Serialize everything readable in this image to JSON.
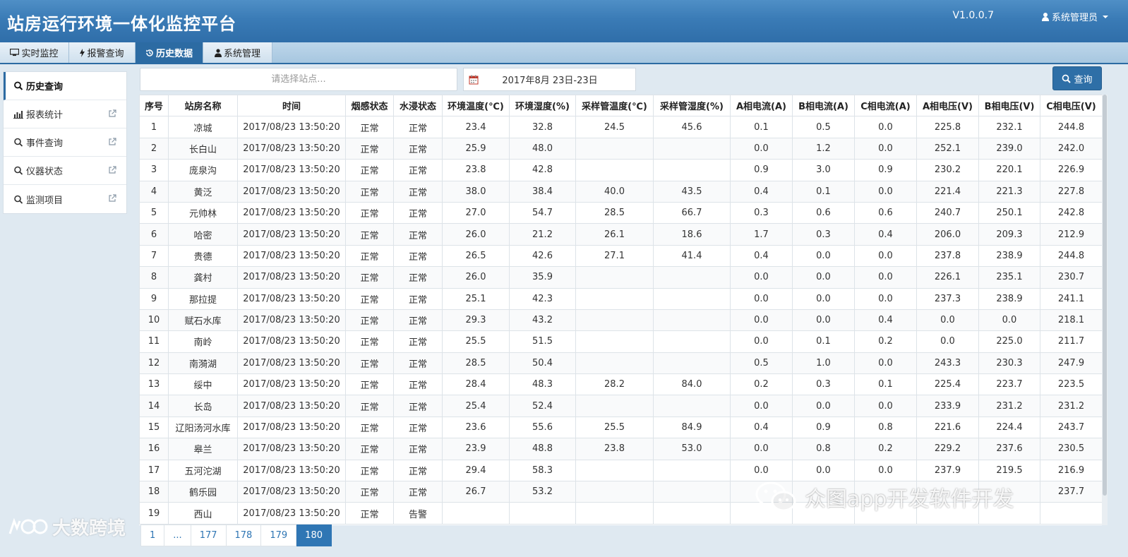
{
  "header": {
    "title": "站房运行环境一体化监控平台",
    "version": "V1.0.0.7",
    "user": "系统管理员"
  },
  "tabs": [
    {
      "label": "实时监控",
      "icon": "monitor-icon",
      "active": false
    },
    {
      "label": "报警查询",
      "icon": "bolt-icon",
      "active": false
    },
    {
      "label": "历史数据",
      "icon": "history-icon",
      "active": true
    },
    {
      "label": "系统管理",
      "icon": "user-icon",
      "active": false
    }
  ],
  "sidebar": {
    "items": [
      {
        "label": "历史查询",
        "icon": "search-icon",
        "active": true
      },
      {
        "label": "报表统计",
        "icon": "bar-chart-icon",
        "active": false
      },
      {
        "label": "事件查询",
        "icon": "search-icon",
        "active": false
      },
      {
        "label": "仪器状态",
        "icon": "search-icon",
        "active": false
      },
      {
        "label": "监测项目",
        "icon": "search-icon",
        "active": false
      }
    ]
  },
  "search": {
    "placeholder": "请选择站点...",
    "date_range": "2017年8月 23日-23日",
    "query_label": "查询"
  },
  "table": {
    "headers": [
      "序号",
      "站房名称",
      "时间",
      "烟感状态",
      "水浸状态",
      "环境温度(℃)",
      "环境湿度(%)",
      "采样管温度(℃)",
      "采样管湿度(%)",
      "A相电流(A)",
      "B相电流(A)",
      "C相电流(A)",
      "A相电压(V)",
      "B相电压(V)",
      "C相电压(V)"
    ],
    "rows": [
      [
        "1",
        "凉城",
        "2017/08/23 13:50:20",
        "正常",
        "正常",
        "23.4",
        "32.8",
        "24.5",
        "45.6",
        "0.1",
        "0.5",
        "0.0",
        "225.8",
        "232.1",
        "244.8"
      ],
      [
        "2",
        "长白山",
        "2017/08/23 13:50:20",
        "正常",
        "正常",
        "25.9",
        "48.0",
        "",
        "",
        "0.0",
        "1.2",
        "0.0",
        "252.1",
        "239.0",
        "242.0"
      ],
      [
        "3",
        "庞泉沟",
        "2017/08/23 13:50:20",
        "正常",
        "正常",
        "23.8",
        "42.8",
        "",
        "",
        "0.9",
        "3.0",
        "0.9",
        "230.2",
        "220.1",
        "226.9"
      ],
      [
        "4",
        "黄泛",
        "2017/08/23 13:50:20",
        "正常",
        "正常",
        "38.0",
        "38.4",
        "40.0",
        "43.5",
        "0.4",
        "0.1",
        "0.0",
        "221.4",
        "221.3",
        "227.8"
      ],
      [
        "5",
        "元帅林",
        "2017/08/23 13:50:20",
        "正常",
        "正常",
        "27.0",
        "54.7",
        "28.5",
        "66.7",
        "0.3",
        "0.6",
        "0.6",
        "240.7",
        "250.1",
        "242.8"
      ],
      [
        "6",
        "哈密",
        "2017/08/23 13:50:20",
        "正常",
        "正常",
        "26.0",
        "21.2",
        "26.1",
        "18.6",
        "1.7",
        "0.3",
        "0.4",
        "206.0",
        "209.3",
        "212.9"
      ],
      [
        "7",
        "贵德",
        "2017/08/23 13:50:20",
        "正常",
        "正常",
        "26.5",
        "42.6",
        "27.1",
        "41.4",
        "0.4",
        "0.0",
        "0.0",
        "237.8",
        "238.9",
        "244.8"
      ],
      [
        "8",
        "龚村",
        "2017/08/23 13:50:20",
        "正常",
        "正常",
        "26.0",
        "35.9",
        "",
        "",
        "0.0",
        "0.0",
        "0.0",
        "226.1",
        "235.1",
        "230.7"
      ],
      [
        "9",
        "那拉提",
        "2017/08/23 13:50:20",
        "正常",
        "正常",
        "25.1",
        "42.3",
        "",
        "",
        "0.0",
        "0.0",
        "0.0",
        "237.3",
        "238.9",
        "241.1"
      ],
      [
        "10",
        "赋石水库",
        "2017/08/23 13:50:20",
        "正常",
        "正常",
        "29.3",
        "43.2",
        "",
        "",
        "0.0",
        "0.0",
        "0.4",
        "0.0",
        "0.0",
        "218.1"
      ],
      [
        "11",
        "南岭",
        "2017/08/23 13:50:20",
        "正常",
        "正常",
        "25.5",
        "51.5",
        "",
        "",
        "0.0",
        "0.1",
        "0.2",
        "0.0",
        "225.0",
        "211.7"
      ],
      [
        "12",
        "南漪湖",
        "2017/08/23 13:50:20",
        "正常",
        "正常",
        "28.5",
        "50.4",
        "",
        "",
        "0.5",
        "1.0",
        "0.0",
        "243.3",
        "230.3",
        "247.9"
      ],
      [
        "13",
        "绥中",
        "2017/08/23 13:50:20",
        "正常",
        "正常",
        "28.4",
        "48.3",
        "28.2",
        "84.0",
        "0.2",
        "0.3",
        "0.1",
        "225.4",
        "223.7",
        "223.5"
      ],
      [
        "14",
        "长岛",
        "2017/08/23 13:50:20",
        "正常",
        "正常",
        "25.4",
        "52.4",
        "",
        "",
        "0.0",
        "0.0",
        "0.0",
        "233.9",
        "231.2",
        "231.2"
      ],
      [
        "15",
        "辽阳汤河水库",
        "2017/08/23 13:50:20",
        "正常",
        "正常",
        "23.6",
        "55.6",
        "25.5",
        "84.9",
        "0.4",
        "0.9",
        "0.8",
        "221.6",
        "224.4",
        "243.7"
      ],
      [
        "16",
        "皋兰",
        "2017/08/23 13:50:20",
        "正常",
        "正常",
        "23.9",
        "48.8",
        "23.8",
        "53.0",
        "0.0",
        "0.8",
        "0.2",
        "229.2",
        "237.6",
        "230.5"
      ],
      [
        "17",
        "五河沱湖",
        "2017/08/23 13:50:20",
        "正常",
        "正常",
        "29.4",
        "58.3",
        "",
        "",
        "0.0",
        "0.0",
        "0.0",
        "237.9",
        "219.5",
        "216.9"
      ],
      [
        "18",
        "鹤乐园",
        "2017/08/23 13:50:20",
        "正常",
        "正常",
        "26.7",
        "53.2",
        "",
        "",
        "",
        "",
        "",
        "",
        "",
        "237.7"
      ],
      [
        "19",
        "西山",
        "2017/08/23 13:50:20",
        "正常",
        "告警",
        "",
        "",
        "",
        "",
        "",
        "",
        "",
        "",
        "",
        ""
      ]
    ]
  },
  "pagination": {
    "pages": [
      "1",
      "...",
      "177",
      "178",
      "179",
      "180"
    ],
    "active": "180"
  },
  "watermarks": {
    "left": "大数跨境",
    "right": "众图app开发软件开发"
  },
  "colors": {
    "header_blue": "#3a7bb6",
    "active_tab": "#2c6ba3",
    "link_blue": "#2f76b4"
  }
}
